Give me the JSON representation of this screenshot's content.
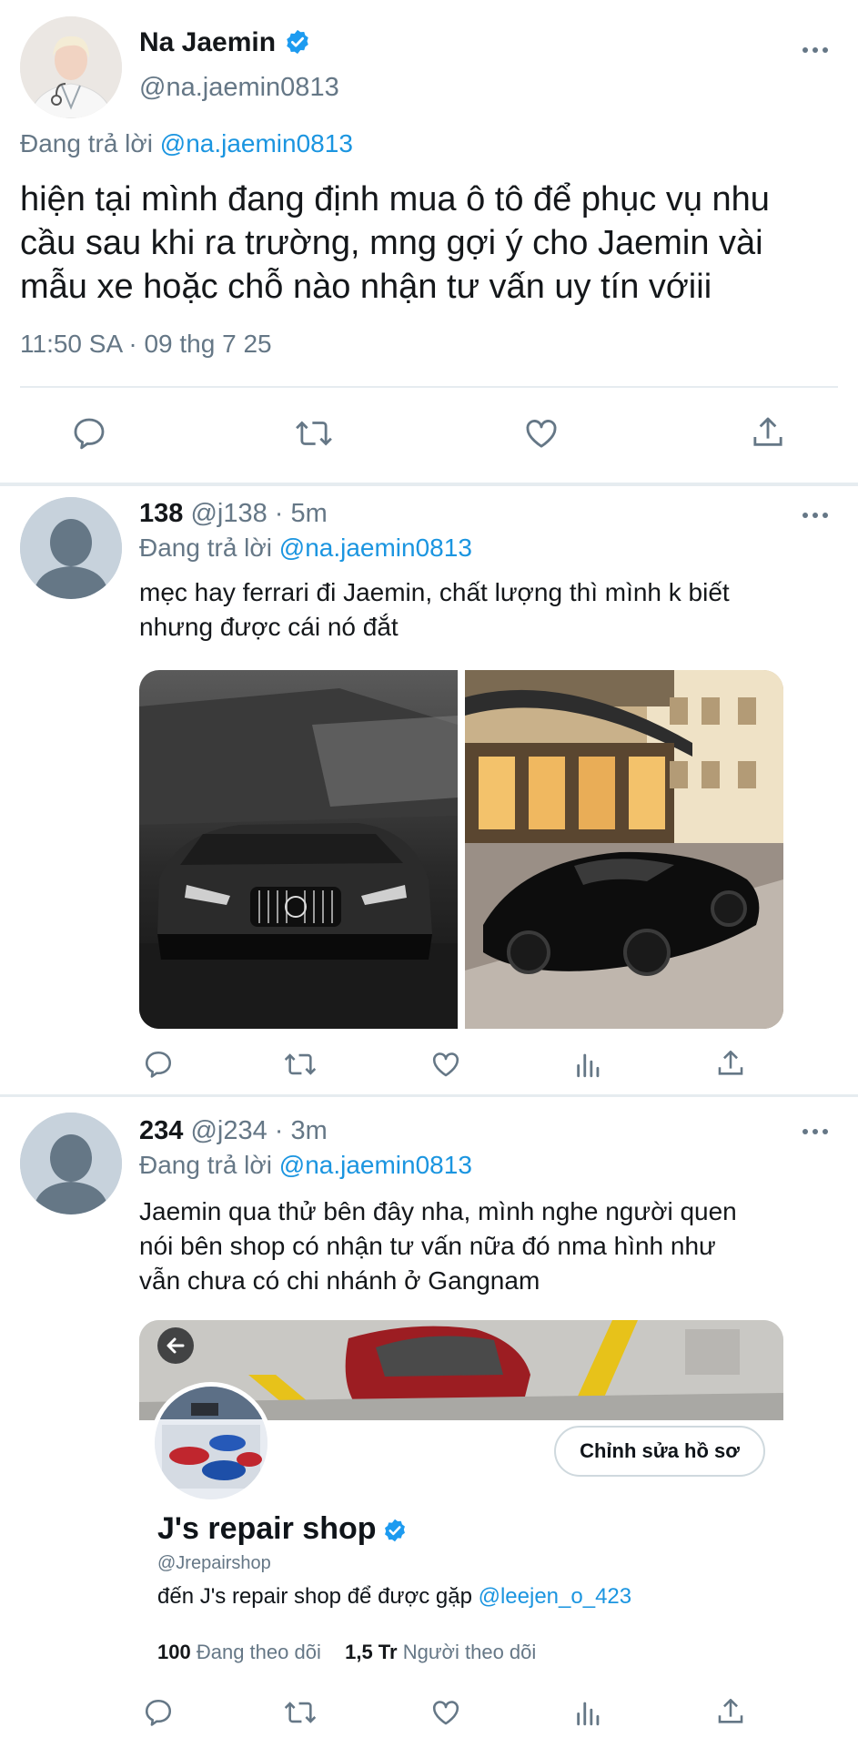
{
  "main_tweet": {
    "display_name": "Na Jaemin",
    "handle": "@na.jaemin0813",
    "reply_label": "Đang trả lời",
    "reply_to": "@na.jaemin0813",
    "text_lines": [
      "hiện tại mình đang định mua ô tô để phục vụ nhu",
      "cầu sau khi ra trường, mng gợi ý cho Jaemin vài",
      "mẫu xe hoặc chỗ nào nhận tư vấn uy tín vớiii"
    ],
    "timestamp": "11:50 SA · 09 thg 7 25"
  },
  "reply1": {
    "display_name": "138",
    "handle_time": "@j138 · 5m",
    "reply_label": "Đang trả lời",
    "reply_to": "@na.jaemin0813",
    "text_lines": [
      "mẹc hay ferrari đi Jaemin, chất lượng thì mình k biết",
      "nhưng được cái nó đắt"
    ]
  },
  "reply2": {
    "display_name": "234",
    "handle_time": "@j234 · 3m",
    "reply_label": "Đang trả lời",
    "reply_to": "@na.jaemin0813",
    "text_lines": [
      "Jaemin qua thử bên đây nha, mình nghe người quen",
      "nói bên shop có nhận tư vấn nữa đó nma hình như",
      "vẫn chưa có chi nhánh ở Gangnam"
    ],
    "profile_card": {
      "edit_button": "Chỉnh sửa hồ sơ",
      "name": "J's repair shop",
      "handle": "@Jrepairshop",
      "bio_text": "đến J's repair shop để được gặp",
      "bio_mention": "@leejen_o_423",
      "following_count": "100",
      "following_label": "Đang theo dõi",
      "followers_count": "1,5 Tr",
      "followers_label": "Người theo dõi"
    }
  },
  "colors": {
    "accent": "#1b95e0",
    "verified": "#1d9bf0",
    "secondary_text": "#657786",
    "divider": "#e6ecf0"
  }
}
